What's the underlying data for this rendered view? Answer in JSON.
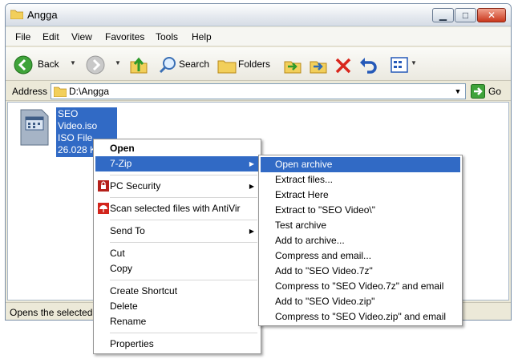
{
  "window": {
    "title": "Angga"
  },
  "menubar": [
    "File",
    "Edit",
    "View",
    "Favorites",
    "Tools",
    "Help"
  ],
  "toolbar": {
    "back_label": "Back",
    "search_label": "Search",
    "folders_label": "Folders"
  },
  "address": {
    "label": "Address",
    "path": "D:\\Angga",
    "go_label": "Go"
  },
  "file": {
    "name": "SEO Video.iso",
    "type": "ISO File",
    "size": "26.028 KB"
  },
  "status": {
    "text": "Opens the selected"
  },
  "context_menu": {
    "open": "Open",
    "seven_zip": "7-Zip",
    "pc_security": "PC Security",
    "antivir": "Scan selected files with AntiVir",
    "send_to": "Send To",
    "cut": "Cut",
    "copy": "Copy",
    "create_shortcut": "Create Shortcut",
    "delete": "Delete",
    "rename": "Rename",
    "properties": "Properties"
  },
  "submenu": [
    "Open archive",
    "Extract files...",
    "Extract Here",
    "Extract to \"SEO Video\\\"",
    "Test archive",
    "Add to archive...",
    "Compress and email...",
    "Add to \"SEO Video.7z\"",
    "Compress to \"SEO Video.7z\" and email",
    "Add to \"SEO Video.zip\"",
    "Compress to \"SEO Video.zip\" and email"
  ],
  "colors": {
    "selection": "#316ac5",
    "titlebar": "#e4e8ee",
    "close": "#c9371c"
  }
}
